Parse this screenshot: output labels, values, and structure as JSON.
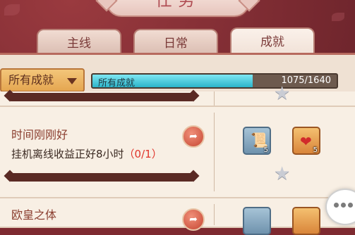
{
  "header": {
    "title": "任务"
  },
  "tabs": [
    {
      "label": "主线",
      "active": false
    },
    {
      "label": "日常",
      "active": false
    },
    {
      "label": "成就",
      "active": true
    }
  ],
  "filter": {
    "dropdown_label": "所有成就",
    "progress_label": "所有成就",
    "progress_text": "1075/1640",
    "progress_fraction": 0.655
  },
  "achievements": [
    {
      "title": "时间刚刚好",
      "description": "挂机离线收益正好8小时",
      "progress": "（0/1）",
      "rewards": [
        {
          "icon": "scroll-icon",
          "count": "5",
          "color": "#7f9fb8"
        },
        {
          "icon": "heart-medal-icon",
          "count": "5",
          "color": "#e1913f"
        }
      ]
    },
    {
      "title": "欧皇之体",
      "description": "",
      "progress": "",
      "rewards": []
    }
  ],
  "colors": {
    "panel": "#f6ece1",
    "accent_red": "#e0342a",
    "progress_fill": "#2cb4c9",
    "dropdown": "#e5a651"
  }
}
